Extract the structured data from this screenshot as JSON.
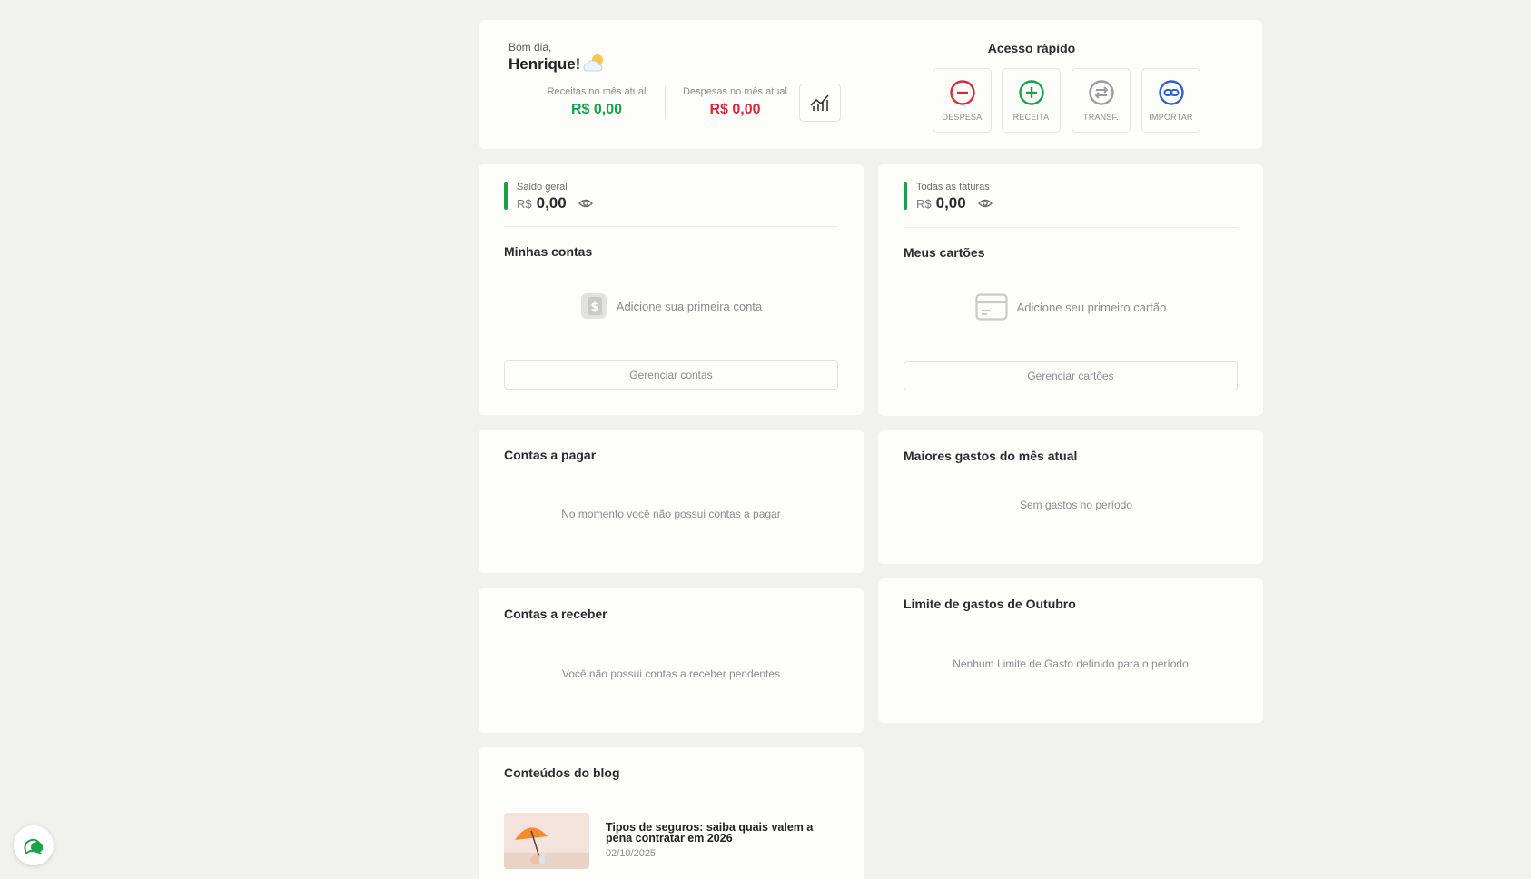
{
  "header": {
    "greeting": "Bom dia,",
    "name": "Henrique!",
    "income_label": "Receitas no mês atual",
    "income_value": "R$ 0,00",
    "expense_label": "Despesas no mês atual",
    "expense_value": "R$ 0,00",
    "chart_icon": "chart-trend-icon",
    "weather_icon": "partly-cloudy-icon"
  },
  "quick_access": {
    "title": "Acesso rápido",
    "items": [
      {
        "label": "DESPESA",
        "icon": "minus-circle-icon",
        "color": "#d62b3f"
      },
      {
        "label": "RECEITA",
        "icon": "plus-circle-icon",
        "color": "#19a24a"
      },
      {
        "label": "TRANSF.",
        "icon": "transfer-icon",
        "color": "#9a9c9e"
      },
      {
        "label": "IMPORTAR",
        "icon": "link-icon",
        "color": "#2f5fd0"
      }
    ]
  },
  "accounts": {
    "balance_label": "Saldo geral",
    "currency": "R$",
    "balance_value": "0,00",
    "title": "Minhas contas",
    "empty_text": "Adicione sua primeira conta",
    "manage_label": "Gerenciar contas"
  },
  "cards": {
    "balance_label": "Todas as faturas",
    "currency": "R$",
    "balance_value": "0,00",
    "title": "Meus cartões",
    "empty_text": "Adicione seu primeiro cartão",
    "manage_label": "Gerenciar cartões"
  },
  "payables": {
    "title": "Contas a pagar",
    "empty_text": "No momento você não possui contas a pagar"
  },
  "top_expenses": {
    "title": "Maiores gastos do mês atual",
    "empty_text": "Sem gastos no período"
  },
  "receivables": {
    "title": "Contas a receber",
    "empty_text": "Você não possui contas a receber pendentes"
  },
  "spending_limit": {
    "title": "Limite de gastos de Outubro",
    "empty_text": "Nenhum Limite de Gasto definido para o período"
  },
  "blog": {
    "title": "Conteúdos do blog",
    "posts": [
      {
        "title": "Tipos de seguros: saiba quais valem a pena contratar em 2026",
        "date": "02/10/2025"
      }
    ]
  },
  "colors": {
    "accent_green": "#19a24a",
    "accent_red": "#d62b3f",
    "accent_blue": "#2f5fd0",
    "background": "#f1f2ee"
  }
}
